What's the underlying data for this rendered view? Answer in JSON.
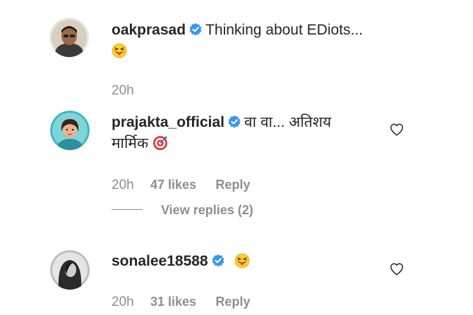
{
  "comments": [
    {
      "username": "oakprasad",
      "text": "Thinking about EDiots...",
      "emoji": "squinting-tongue-emoji",
      "time": "20h"
    },
    {
      "username": "prajakta_official",
      "text_line1": "वा वा... अतिशय",
      "text_line2": "मार्मिक",
      "emoji": "direct-hit-target-emoji",
      "time": "20h",
      "likes": "47 likes",
      "reply_label": "Reply",
      "view_replies": "View replies (2)"
    },
    {
      "username": "sonalee18588",
      "emoji": "squinting-tongue-emoji",
      "time": "20h",
      "likes": "31 likes",
      "reply_label": "Reply"
    }
  ],
  "colors": {
    "text": "#262626",
    "muted": "#8e8e8e",
    "verified": "#3897f0"
  },
  "icons": [
    "verified-badge-icon",
    "heart-outline-icon"
  ]
}
